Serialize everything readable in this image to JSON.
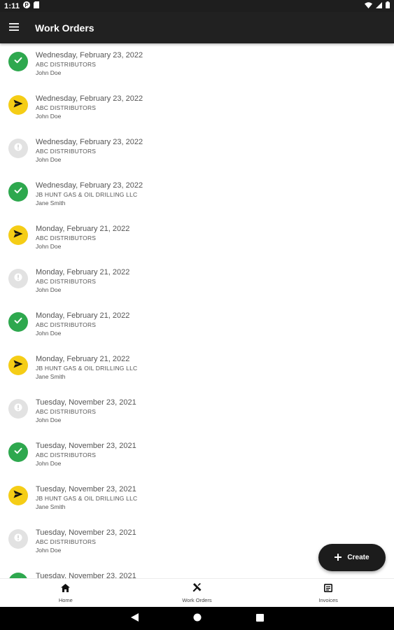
{
  "status_bar": {
    "time": "1:11"
  },
  "app_bar": {
    "title": "Work Orders"
  },
  "colors": {
    "completed": "#2ea84e",
    "sent": "#f5cd16",
    "draft": "#e2e2e2",
    "app_bar": "#212121"
  },
  "work_orders": [
    {
      "date": "Wednesday, February 23, 2022",
      "company": "ABC DISTRIBUTORS",
      "person": "John Doe",
      "status": "completed"
    },
    {
      "date": "Wednesday, February 23, 2022",
      "company": "ABC DISTRIBUTORS",
      "person": "John Doe",
      "status": "sent"
    },
    {
      "date": "Wednesday, February 23, 2022",
      "company": "ABC DISTRIBUTORS",
      "person": "John Doe",
      "status": "draft"
    },
    {
      "date": "Wednesday, February 23, 2022",
      "company": "JB HUNT GAS & OIL DRILLING LLC",
      "person": "Jane Smith",
      "status": "completed"
    },
    {
      "date": "Monday, February 21, 2022",
      "company": "ABC DISTRIBUTORS",
      "person": "John Doe",
      "status": "sent"
    },
    {
      "date": "Monday, February 21, 2022",
      "company": "ABC DISTRIBUTORS",
      "person": "John Doe",
      "status": "draft"
    },
    {
      "date": "Monday, February 21, 2022",
      "company": "ABC DISTRIBUTORS",
      "person": "John Doe",
      "status": "completed"
    },
    {
      "date": "Monday, February 21, 2022",
      "company": "JB HUNT GAS & OIL DRILLING LLC",
      "person": "Jane Smith",
      "status": "sent"
    },
    {
      "date": "Tuesday, November 23, 2021",
      "company": "ABC DISTRIBUTORS",
      "person": "John Doe",
      "status": "draft"
    },
    {
      "date": "Tuesday, November 23, 2021",
      "company": "ABC DISTRIBUTORS",
      "person": "John Doe",
      "status": "completed"
    },
    {
      "date": "Tuesday, November 23, 2021",
      "company": "JB HUNT GAS & OIL DRILLING LLC",
      "person": "Jane Smith",
      "status": "sent"
    },
    {
      "date": "Tuesday, November 23, 2021",
      "company": "ABC DISTRIBUTORS",
      "person": "John Doe",
      "status": "draft"
    },
    {
      "date": "Tuesday, November 23, 2021",
      "company": "",
      "person": "",
      "status": "completed"
    }
  ],
  "fab": {
    "label": "Create"
  },
  "bottom_nav": {
    "home": "Home",
    "work_orders": "Work Orders",
    "invoices": "Invoices"
  }
}
